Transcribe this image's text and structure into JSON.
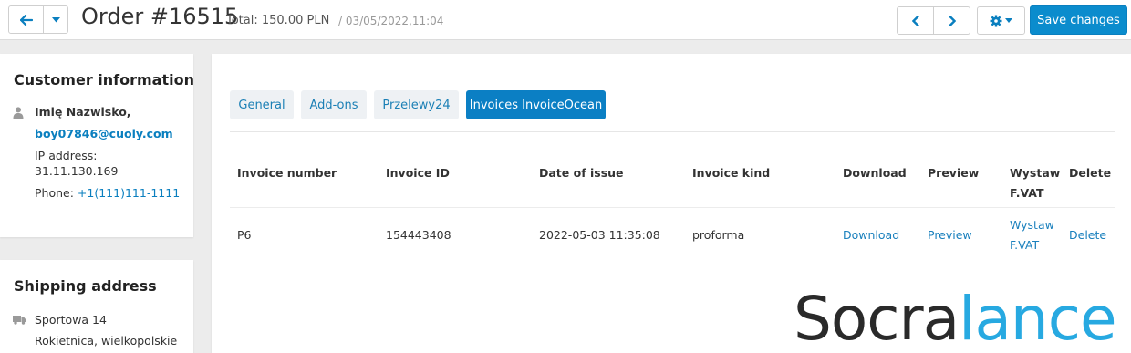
{
  "header": {
    "title": "Order #16515",
    "total": "Total: 150.00 PLN",
    "date": "/ 03/05/2022,11:04",
    "save_label": "Save changes"
  },
  "customer": {
    "title": "Customer information",
    "name": "Imię Nazwisko,",
    "email": "boy07846@cuoly.com",
    "ip_label": "IP address:",
    "ip": "31.11.130.169",
    "phone_label": "Phone:",
    "phone": "+1(111)111-1111"
  },
  "shipping": {
    "title": "Shipping address",
    "street": "Sportowa 14",
    "city": "Rokietnica, wielkopolskie"
  },
  "tabs": [
    {
      "label": "General",
      "active": false
    },
    {
      "label": "Add-ons",
      "active": false
    },
    {
      "label": "Przelewy24",
      "active": false
    },
    {
      "label": "Invoices InvoiceOcean",
      "active": true
    }
  ],
  "table": {
    "headers": [
      "Invoice number",
      "Invoice ID",
      "Date of issue",
      "Invoice kind",
      "Download",
      "Preview",
      "Wystaw",
      "F.VAT",
      "Delete"
    ],
    "row": {
      "number": "P6",
      "id": "154443408",
      "date": "2022-05-03 11:35:08",
      "kind": "proforma",
      "download": "Download",
      "preview": "Preview",
      "issue_1": "Wystaw",
      "issue_2": "F.VAT",
      "delete": "Delete"
    }
  },
  "watermark": {
    "part1": "Socra",
    "part2": "lance"
  },
  "colors": {
    "accent": "#0b8ccd",
    "link": "#1a80bd",
    "watermark_blue": "#27a9e1"
  }
}
